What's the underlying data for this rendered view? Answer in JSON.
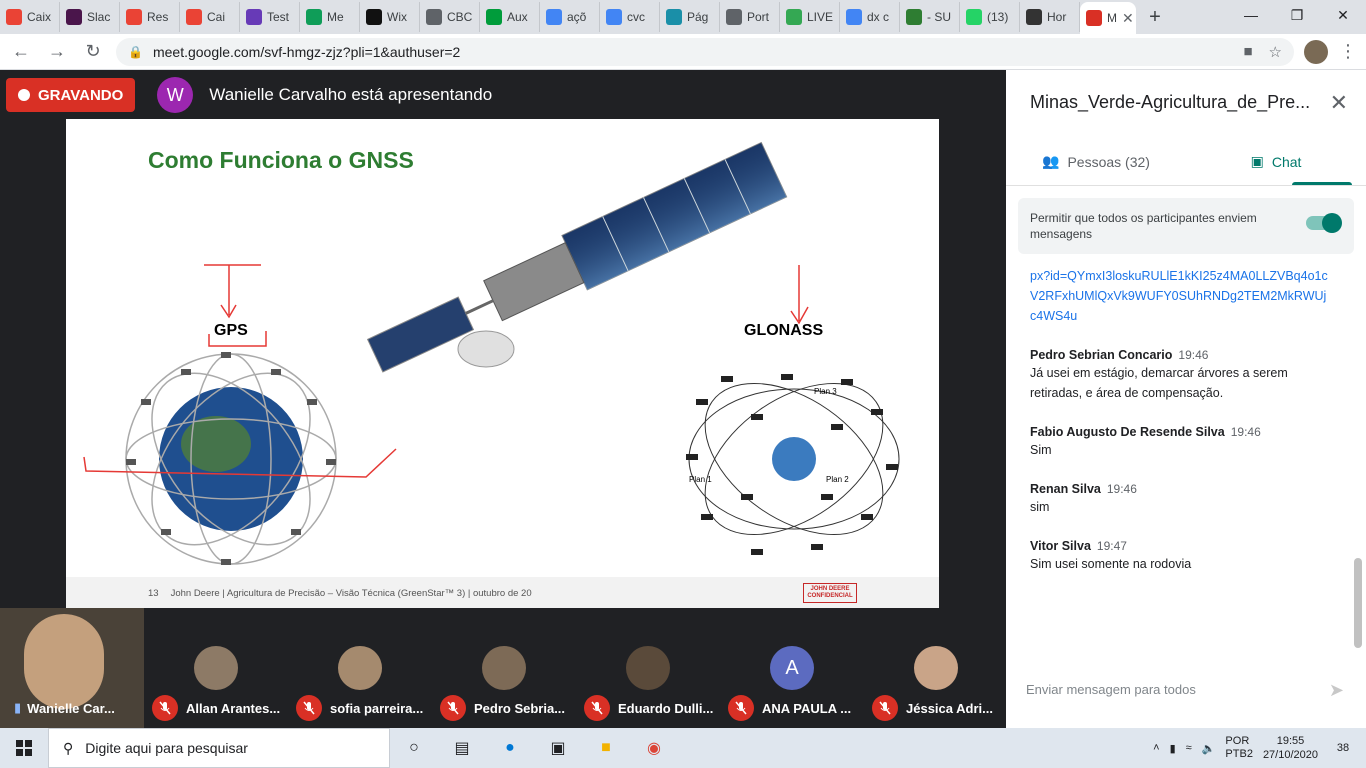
{
  "browser": {
    "tabs": [
      {
        "label": "Caix",
        "icon": "gmail-icon",
        "color": "#ea4335"
      },
      {
        "label": "Slac",
        "icon": "slack-icon",
        "color": "#4a154b"
      },
      {
        "label": "Res",
        "icon": "gmail-icon",
        "color": "#ea4335"
      },
      {
        "label": "Cai",
        "icon": "gmail-icon",
        "color": "#ea4335"
      },
      {
        "label": "Test",
        "icon": "forms-icon",
        "color": "#673ab7"
      },
      {
        "label": "Me",
        "icon": "drive-icon",
        "color": "#0f9d58"
      },
      {
        "label": "Wix",
        "icon": "wix-icon",
        "color": "#111111"
      },
      {
        "label": "CBC",
        "icon": "globe-icon",
        "color": "#5f6368"
      },
      {
        "label": "Aux",
        "icon": "flag-icon",
        "color": "#009c3b"
      },
      {
        "label": "açõ",
        "icon": "google-icon",
        "color": "#4285f4"
      },
      {
        "label": "cvc",
        "icon": "google-icon",
        "color": "#4285f4"
      },
      {
        "label": "Pág",
        "icon": "bird-icon",
        "color": "#1a8fa8"
      },
      {
        "label": "Port",
        "icon": "globe-icon",
        "color": "#5f6368"
      },
      {
        "label": "LIVE",
        "icon": "leaf-icon",
        "color": "#34a853"
      },
      {
        "label": "dx c",
        "icon": "google-icon",
        "color": "#4285f4"
      },
      {
        "label": "- SU",
        "icon": "suap-icon",
        "color": "#2e7d32"
      },
      {
        "label": "(13)",
        "icon": "whatsapp-icon",
        "color": "#25d366"
      },
      {
        "label": "Hor",
        "icon": "wg-icon",
        "color": "#333333"
      },
      {
        "label": "M",
        "icon": "recording-icon",
        "color": "#d93025"
      }
    ],
    "url": "meet.google.com/svf-hmgz-zjz?pli=1&authuser=2"
  },
  "meet": {
    "recording_label": "GRAVANDO",
    "presenter_initial": "W",
    "presenter_text": "Wanielle Carvalho está apresentando",
    "slide": {
      "title": "Como Funciona o GNSS",
      "gps_label": "GPS",
      "glonass_label": "GLONASS",
      "footer_page": "13",
      "footer_text": "John Deere | Agricultura de Precisão – Visão Técnica (GreenStar™ 3) | outubro de 20",
      "logo_line1": "JOHN DEERE",
      "logo_line2": "CONFIDENCIAL",
      "plan_labels": [
        "Plan 1",
        "Plan 2",
        "Plan 3"
      ]
    },
    "participants": [
      {
        "name": "Wanielle Car...",
        "self": true
      },
      {
        "name": "Allan Arantes...",
        "initial": ""
      },
      {
        "name": "sofia parreira...",
        "initial": ""
      },
      {
        "name": "Pedro Sebria...",
        "initial": ""
      },
      {
        "name": "Eduardo Dulli...",
        "initial": ""
      },
      {
        "name": "ANA PAULA ...",
        "initial": "A"
      },
      {
        "name": "Jéssica Adri...",
        "initial": ""
      }
    ]
  },
  "panel": {
    "title": "Minas_Verde-Agricultura_de_Pre...",
    "tab_people": "Pessoas (32)",
    "tab_chat": "Chat",
    "allow_text": "Permitir que todos os participantes enviem mensagens",
    "link_text": "px?id=QYmxI3loskuRULlE1kKI25z4MA0LLZVBq4o1cV2RFxhUMlQxVk9WUFY0SUhRNDg2TEM2MkRWUjc4WS4u",
    "messages": [
      {
        "sender": "Pedro Sebrian Concario",
        "time": "19:46",
        "body": "Já usei em estágio, demarcar árvores a serem retiradas, e área de compensação."
      },
      {
        "sender": "Fabio Augusto De Resende Silva",
        "time": "19:46",
        "body": "Sim"
      },
      {
        "sender": "Renan Silva",
        "time": "19:46",
        "body": "sim"
      },
      {
        "sender": "Vitor Silva",
        "time": "19:47",
        "body": "Sim usei somente na rodovia"
      }
    ],
    "compose_placeholder": "Enviar mensagem para todos"
  },
  "taskbar": {
    "search_placeholder": "Digite aqui para pesquisar",
    "lang1": "POR",
    "lang2": "PTB2",
    "time": "19:55",
    "date": "27/10/2020",
    "notifications": "38"
  }
}
